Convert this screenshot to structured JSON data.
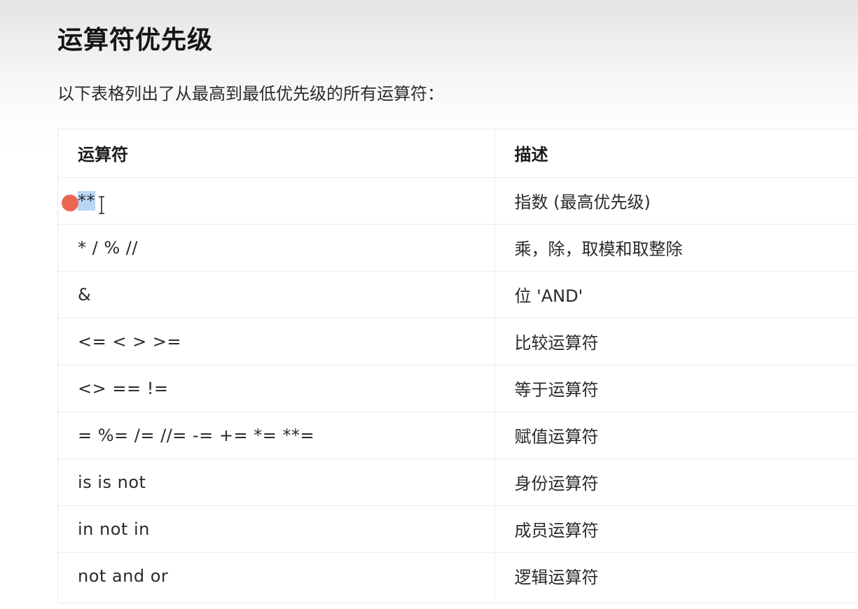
{
  "page": {
    "title": "运算符优先级",
    "intro": "以下表格列出了从最高到最低优先级的所有运算符："
  },
  "table": {
    "headers": [
      "运算符",
      "描述"
    ],
    "rows": [
      {
        "operator_selected": "**",
        "operator_rest": "",
        "description": "指数 (最高优先级)"
      },
      {
        "operator_selected": "",
        "operator_rest": "* / % //",
        "description": "乘，除，取模和取整除"
      },
      {
        "operator_selected": "",
        "operator_rest": "&",
        "description": "位 'AND'"
      },
      {
        "operator_selected": "",
        "operator_rest": "<= < > >=",
        "description": "比较运算符"
      },
      {
        "operator_selected": "",
        "operator_rest": "<> == !=",
        "description": "等于运算符"
      },
      {
        "operator_selected": "",
        "operator_rest": "= %= /= //= -= += *= **=",
        "description": "赋值运算符"
      },
      {
        "operator_selected": "",
        "operator_rest": "is is not",
        "description": "身份运算符"
      },
      {
        "operator_selected": "",
        "operator_rest": "in not in",
        "description": "成员运算符"
      },
      {
        "operator_selected": "",
        "operator_rest": "not and or",
        "description": "逻辑运算符"
      }
    ]
  },
  "colors": {
    "selection": "#b9d6f5",
    "pointer_dot": "#ec5e48"
  },
  "icons": {
    "pointer": "red-dot-pointer",
    "text_cursor": "i-beam-cursor"
  }
}
